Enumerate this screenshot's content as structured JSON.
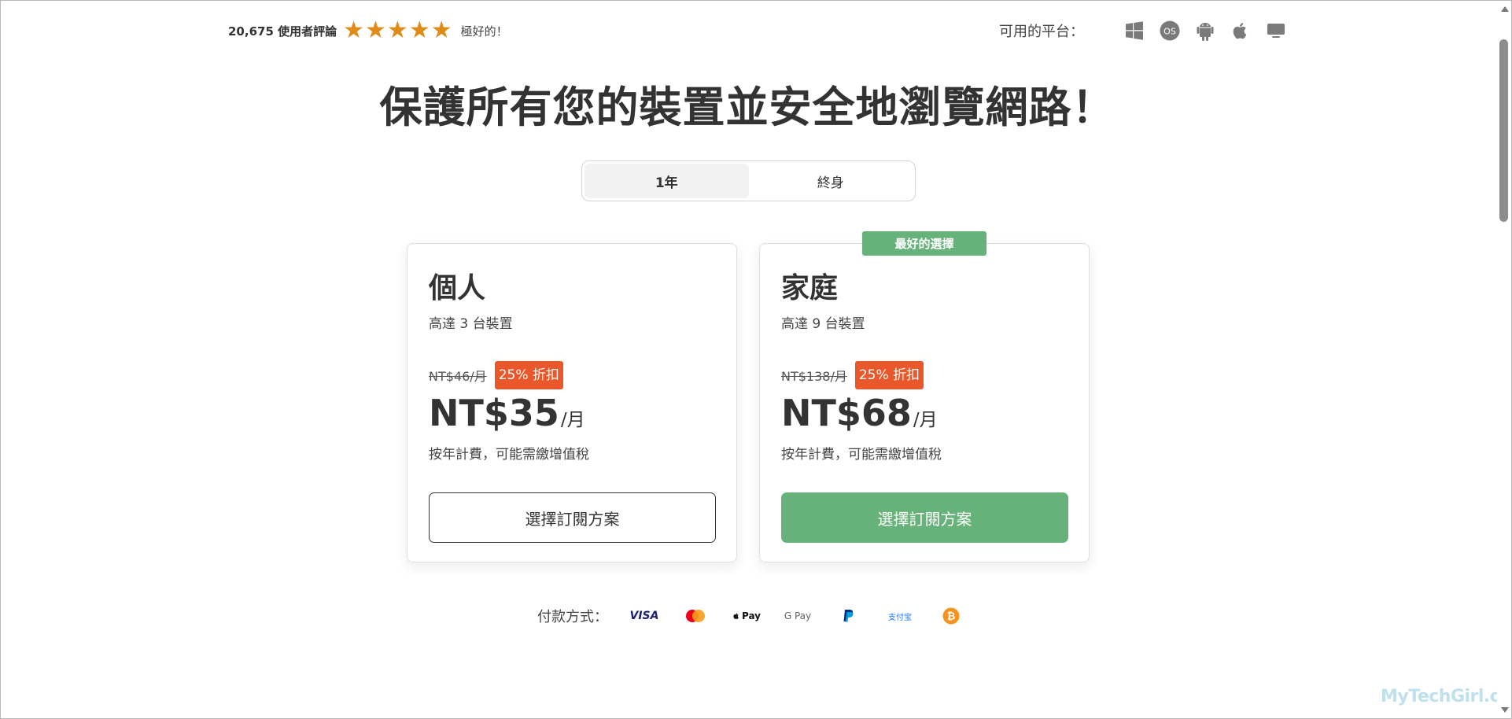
{
  "rating": {
    "count_text": "20,675 使用者評論",
    "stars": [
      "★",
      "★",
      "★",
      "★",
      "★"
    ],
    "word": "極好的！",
    "star_color": "#e08a17"
  },
  "platforms": {
    "label": "可用的平台：",
    "icons": [
      "windows-icon",
      "macos-icon",
      "android-icon",
      "apple-icon",
      "tv-icon"
    ],
    "macos_text": "OS"
  },
  "headline": "保護所有您的裝置並安全地瀏覽網路！",
  "toggle": {
    "options": [
      {
        "label": "1年",
        "active": true
      },
      {
        "label": "終身",
        "active": false
      }
    ]
  },
  "plans": {
    "best_badge": "最好的選擇",
    "personal": {
      "title": "個人",
      "subtitle": "高達 3 台裝置",
      "old_price": "NT$46/月",
      "discount": "25% 折扣",
      "price": "NT$35",
      "unit": "/月",
      "note": "按年計費，可能需繳增值稅",
      "cta": "選擇訂閱方案"
    },
    "family": {
      "title": "家庭",
      "subtitle": "高達 9 台裝置",
      "old_price": "NT$138/月",
      "discount": "25% 折扣",
      "price": "NT$68",
      "unit": "/月",
      "note": "按年計費，可能需繳增值稅",
      "cta": "選擇訂閱方案"
    }
  },
  "payments": {
    "label": "付款方式：",
    "methods": [
      "visa-icon",
      "mastercard-icon",
      "apple-pay-icon",
      "google-pay-icon",
      "paypal-icon",
      "alipay-icon",
      "bitcoin-icon"
    ],
    "visa_text": "VISA",
    "apple_pay_text": "Pay",
    "google_pay_text": "G Pay",
    "alipay_text": "支付宝"
  },
  "watermark": "MyTechGirl.com",
  "colors": {
    "accent_green": "#67b27a",
    "discount_orange": "#e9572a",
    "text_dark": "#333333"
  }
}
